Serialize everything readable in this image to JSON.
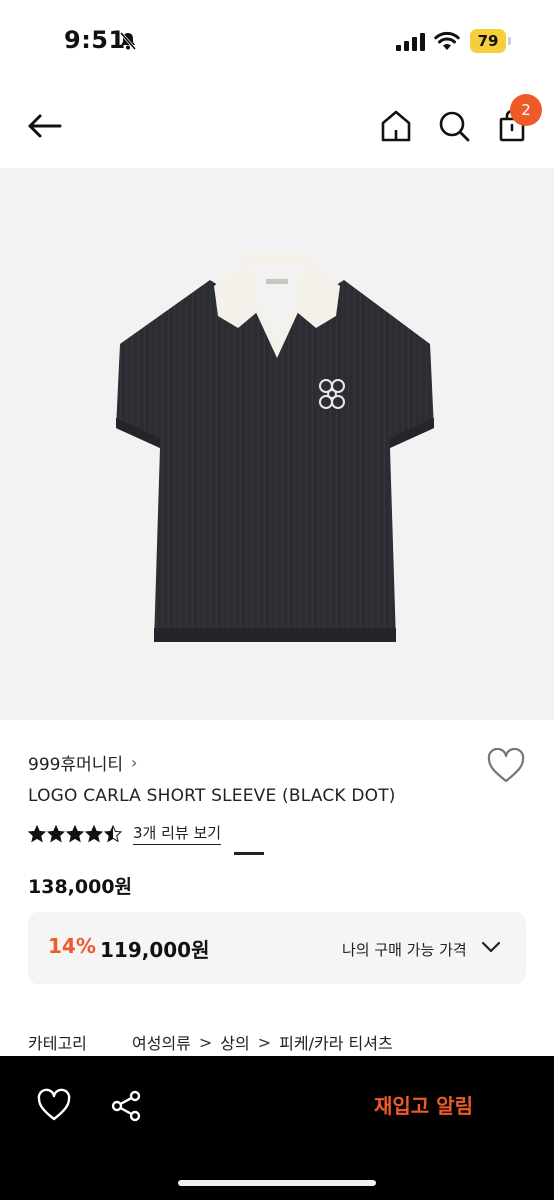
{
  "status": {
    "time": "9:51",
    "battery": "79"
  },
  "header": {
    "cart_count": "2"
  },
  "product": {
    "brand": "999휴머니티",
    "brand_chevron": "›",
    "name": "LOGO CARLA SHORT SLEEVE (BLACK DOT)",
    "rating": 4.5,
    "review_link": "3개 리뷰 보기",
    "price": "138,000원",
    "discount_rate": "14%",
    "discount_price": "119,000원",
    "my_price_label": "나의 구매 가능 가격",
    "image_page": "1"
  },
  "category": {
    "label": "카테고리",
    "path": [
      "여성의류",
      "상의",
      "피케/카라 티셔츠"
    ],
    "separator": ">"
  },
  "bottom_bar": {
    "restock_label": "재입고 알림"
  },
  "colors": {
    "accent": "#f05a28",
    "battery": "#f5cf3b",
    "shirt": "#2b2d33",
    "collar": "#f4f1ea"
  }
}
